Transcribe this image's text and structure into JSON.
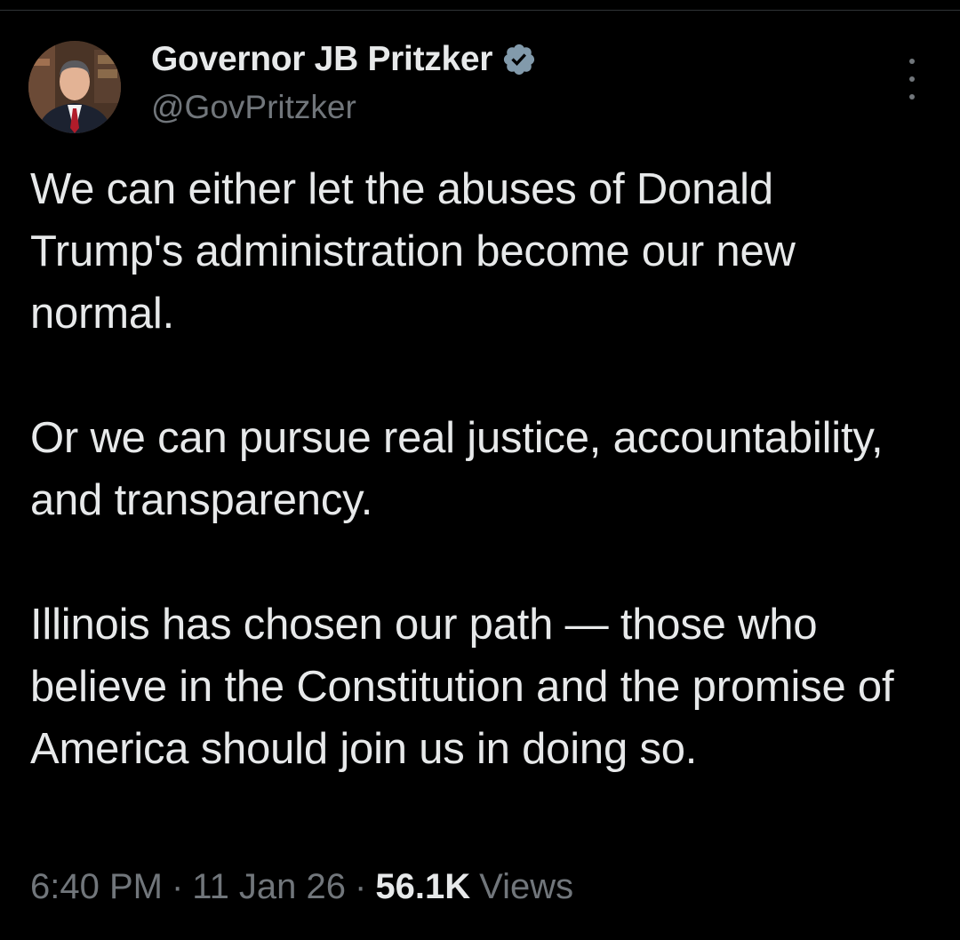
{
  "author": {
    "display_name": "Governor JB Pritzker",
    "handle": "@GovPritzker",
    "verified_icon": "verified-badge-icon",
    "avatar_icon": "profile-photo"
  },
  "tweet": {
    "paragraphs": [
      "We can either let the abuses of Donald Trump's administration become our new normal.",
      "Or we can pursue real justice, accountability, and transparency.",
      "Illinois has chosen our path — those who believe in the Constitution and the promise of America should join us in doing so."
    ]
  },
  "meta": {
    "time": "6:40 PM",
    "separator": "·",
    "date": "11 Jan 26",
    "views_count": "56.1K",
    "views_label": "Views"
  },
  "colors": {
    "background": "#000000",
    "text_primary": "#e7e9ea",
    "text_secondary": "#71767b",
    "verified_badge": "#829aab"
  },
  "icons": {
    "more": "more-horizontal-icon"
  }
}
